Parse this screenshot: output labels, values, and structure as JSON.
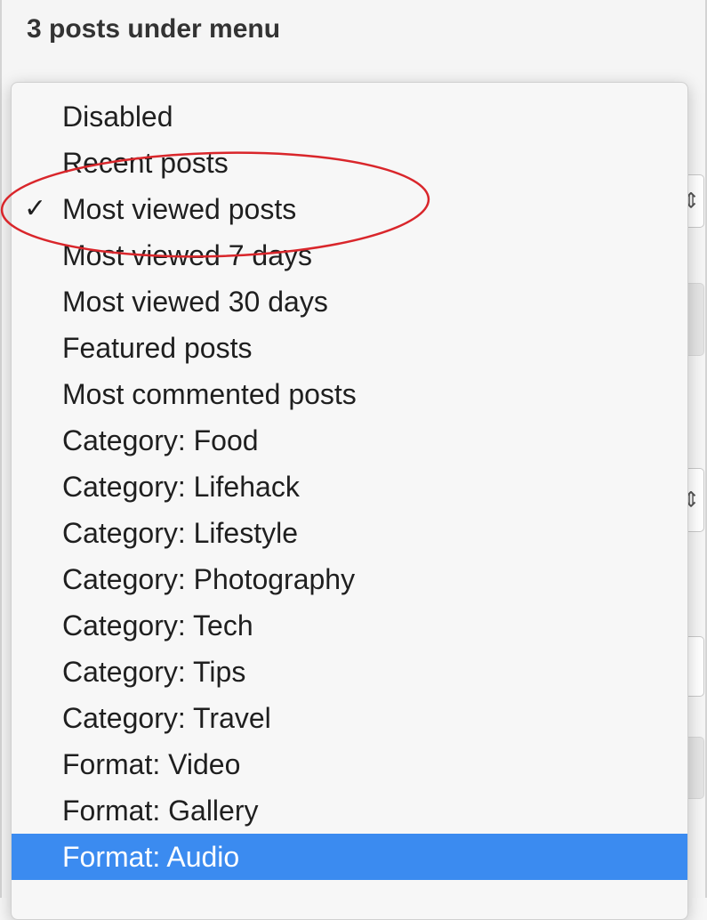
{
  "panel": {
    "title": "3 posts under menu"
  },
  "menu": {
    "items": [
      {
        "label": "Disabled",
        "checked": false,
        "highlighted": false
      },
      {
        "label": "Recent posts",
        "checked": false,
        "highlighted": false
      },
      {
        "label": "Most viewed posts",
        "checked": true,
        "highlighted": false
      },
      {
        "label": "Most viewed 7 days",
        "checked": false,
        "highlighted": false
      },
      {
        "label": "Most viewed 30 days",
        "checked": false,
        "highlighted": false
      },
      {
        "label": "Featured posts",
        "checked": false,
        "highlighted": false
      },
      {
        "label": "Most commented posts",
        "checked": false,
        "highlighted": false
      },
      {
        "label": "Category: Food",
        "checked": false,
        "highlighted": false
      },
      {
        "label": "Category: Lifehack",
        "checked": false,
        "highlighted": false
      },
      {
        "label": "Category: Lifestyle",
        "checked": false,
        "highlighted": false
      },
      {
        "label": "Category: Photography",
        "checked": false,
        "highlighted": false
      },
      {
        "label": "Category: Tech",
        "checked": false,
        "highlighted": false
      },
      {
        "label": "Category: Tips",
        "checked": false,
        "highlighted": false
      },
      {
        "label": "Category: Travel",
        "checked": false,
        "highlighted": false
      },
      {
        "label": "Format: Video",
        "checked": false,
        "highlighted": false
      },
      {
        "label": "Format: Gallery",
        "checked": false,
        "highlighted": false
      },
      {
        "label": "Format: Audio",
        "checked": false,
        "highlighted": true
      }
    ],
    "checkmark": "✓"
  },
  "colors": {
    "highlight": "#3b8bf0",
    "annotation": "#d9262b"
  },
  "icons": {
    "select_arrow": "chevron-up-down-icon"
  }
}
